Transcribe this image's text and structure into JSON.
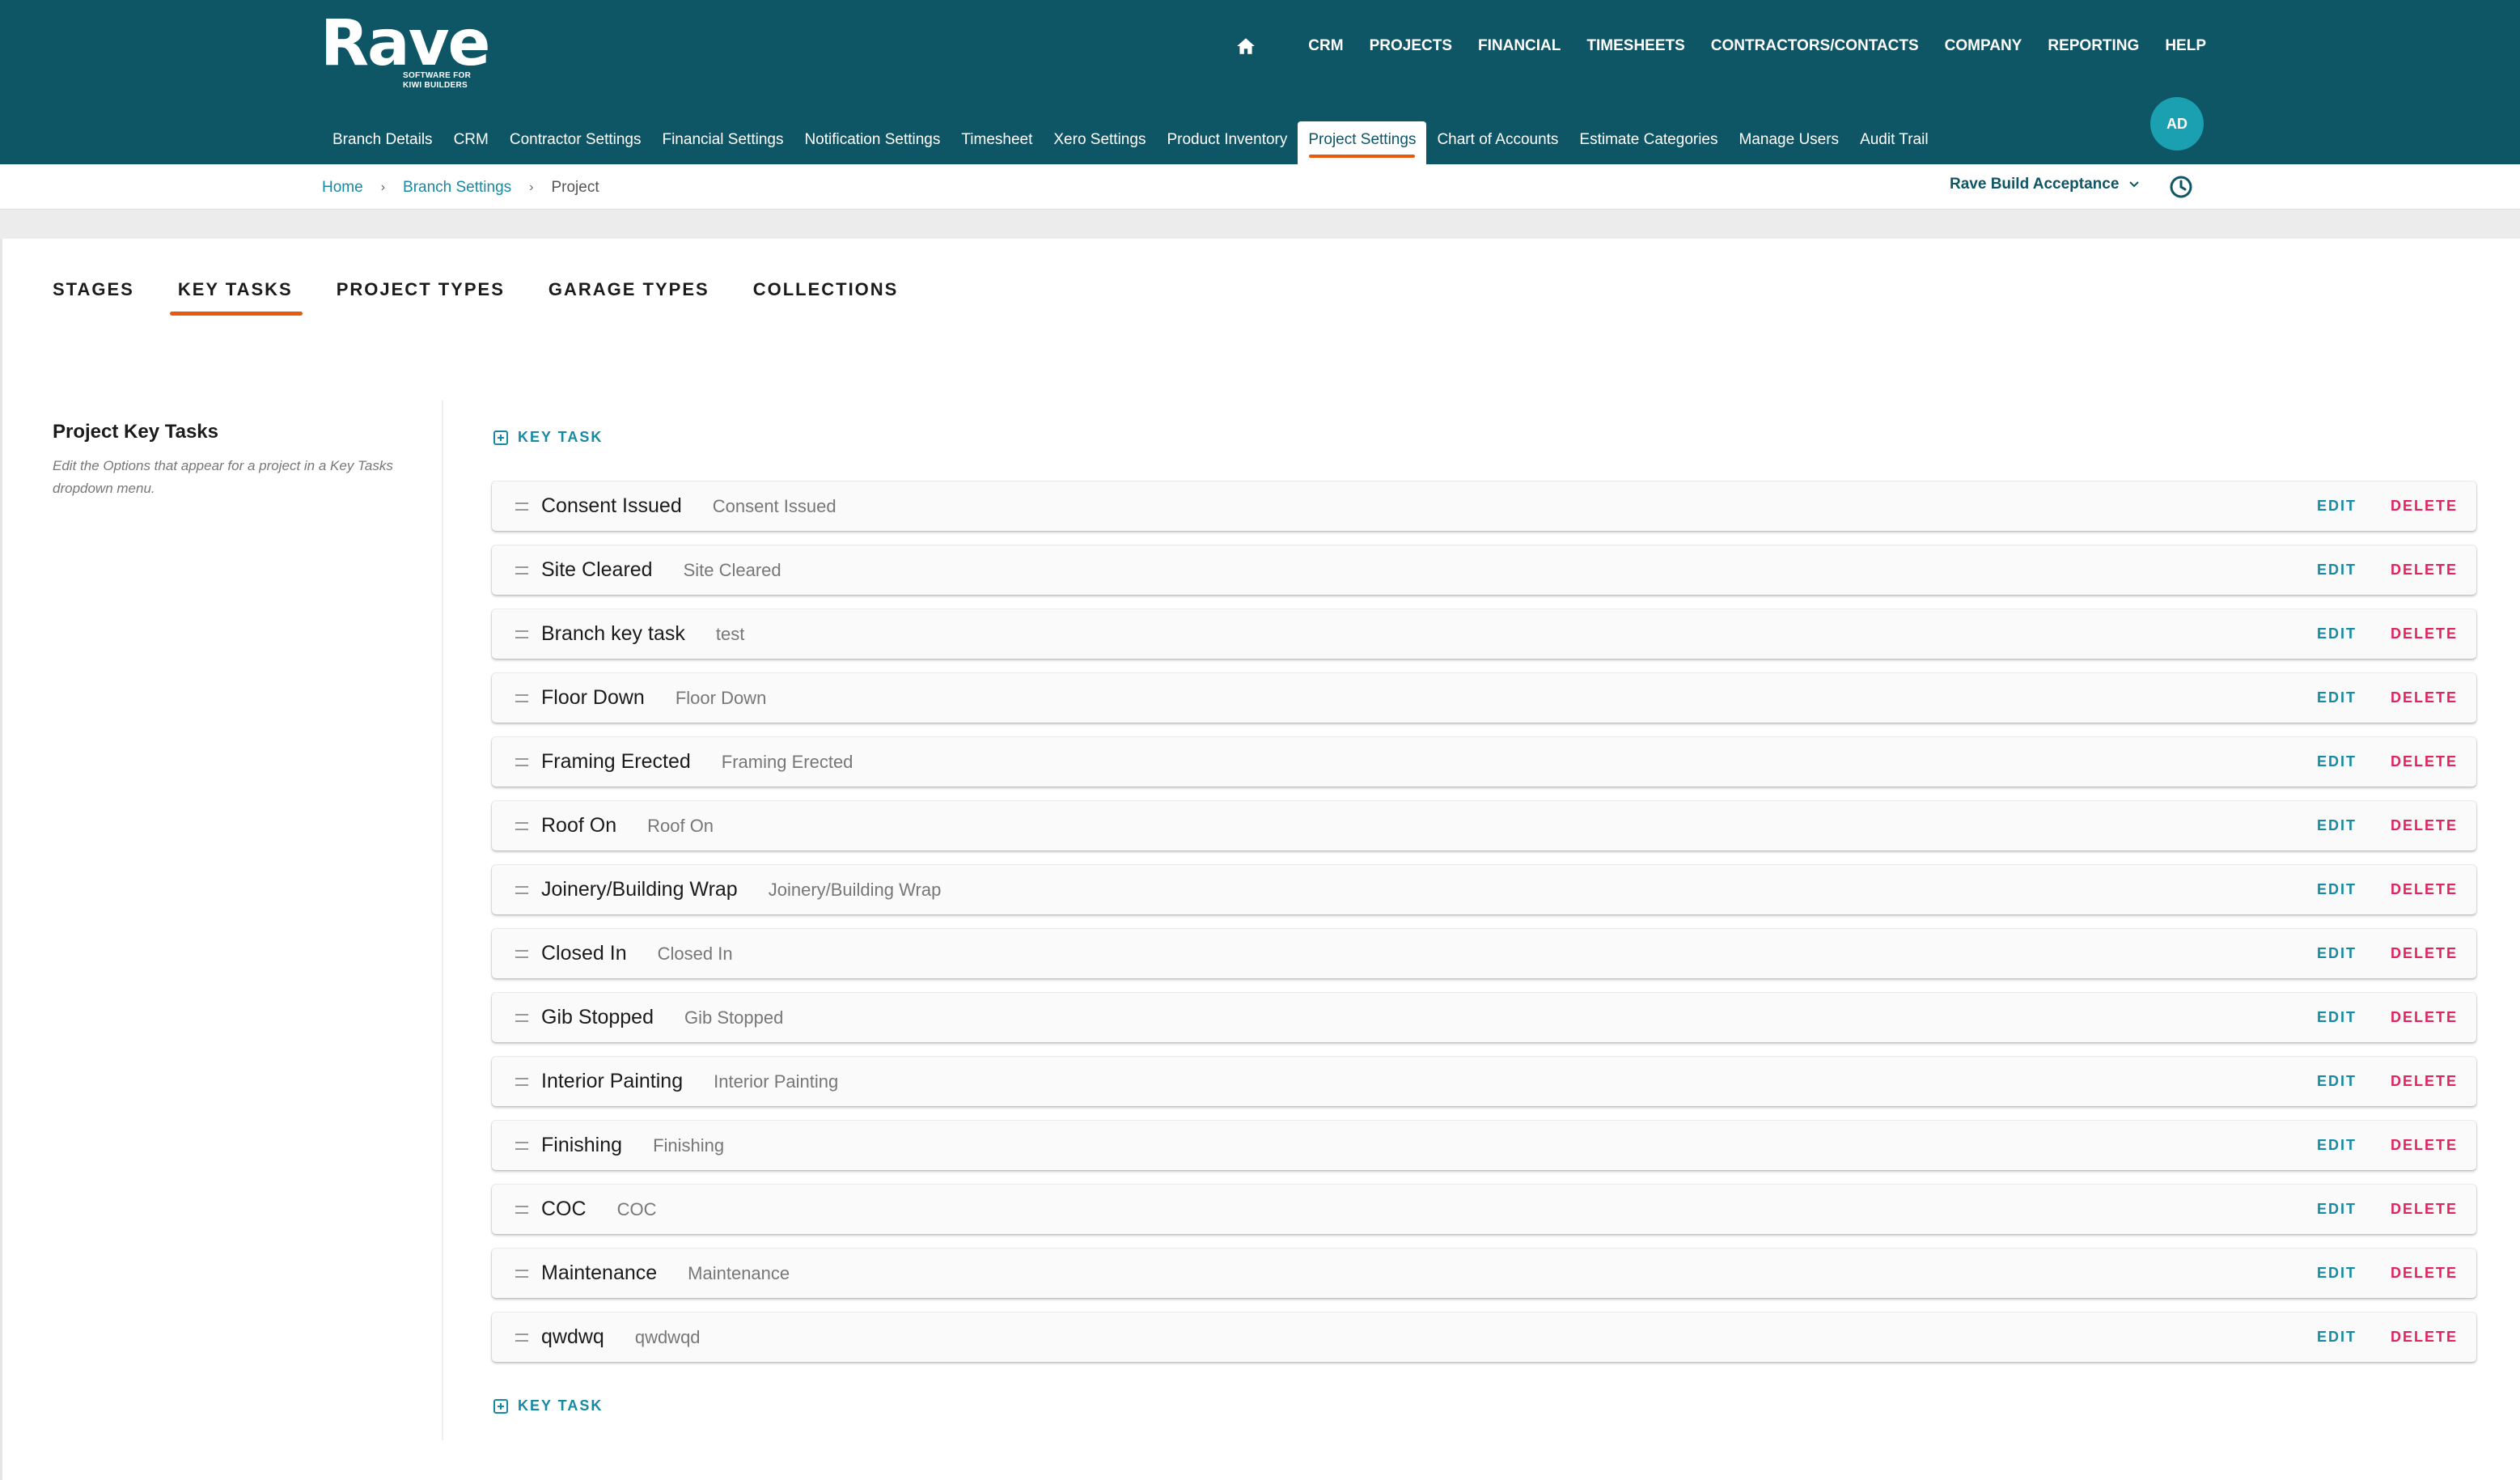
{
  "brand": {
    "name": "Rave",
    "tagline": "SOFTWARE FOR KIWI BUILDERS"
  },
  "main_nav": [
    "CRM",
    "PROJECTS",
    "FINANCIAL",
    "TIMESHEETS",
    "CONTRACTORS/CONTACTS",
    "COMPANY",
    "REPORTING",
    "HELP"
  ],
  "sub_nav": {
    "items": [
      "Branch Details",
      "CRM",
      "Contractor Settings",
      "Financial Settings",
      "Notification Settings",
      "Timesheet",
      "Xero Settings",
      "Product Inventory",
      "Project Settings",
      "Chart of Accounts",
      "Estimate Categories",
      "Manage Users",
      "Audit Trail"
    ],
    "active": "Project Settings"
  },
  "user": {
    "initials": "AD"
  },
  "breadcrumb": {
    "home": "Home",
    "branch_settings": "Branch Settings",
    "current": "Project"
  },
  "branch_selector": {
    "value": "Rave Build Acceptance"
  },
  "tabs": {
    "items": [
      "STAGES",
      "KEY TASKS",
      "PROJECT TYPES",
      "GARAGE TYPES",
      "COLLECTIONS"
    ],
    "active": "KEY TASKS"
  },
  "section": {
    "title": "Project Key Tasks",
    "description": "Edit the Options that appear for a project in a Key Tasks dropdown menu."
  },
  "add_key_task_label": "KEY TASK",
  "actions": {
    "edit": "EDIT",
    "delete": "DELETE"
  },
  "key_tasks": [
    {
      "name": "Consent Issued",
      "description": "Consent Issued"
    },
    {
      "name": "Site Cleared",
      "description": "Site Cleared"
    },
    {
      "name": "Branch key task",
      "description": "test"
    },
    {
      "name": "Floor Down",
      "description": "Floor Down"
    },
    {
      "name": "Framing Erected",
      "description": "Framing Erected"
    },
    {
      "name": "Roof On",
      "description": "Roof On"
    },
    {
      "name": "Joinery/Building Wrap",
      "description": "Joinery/Building Wrap"
    },
    {
      "name": "Closed In",
      "description": "Closed In"
    },
    {
      "name": "Gib Stopped",
      "description": "Gib Stopped"
    },
    {
      "name": "Interior Painting",
      "description": "Interior Painting"
    },
    {
      "name": "Finishing",
      "description": "Finishing"
    },
    {
      "name": "COC",
      "description": "COC"
    },
    {
      "name": "Maintenance",
      "description": "Maintenance"
    },
    {
      "name": "qwdwq",
      "description": "qwdwqd"
    }
  ],
  "colors": {
    "header_bg": "#0e5565",
    "accent_teal": "#1689a3",
    "accent_orange": "#e8590c",
    "delete_red": "#e0245e",
    "avatar_bg": "#1aa0b0"
  }
}
